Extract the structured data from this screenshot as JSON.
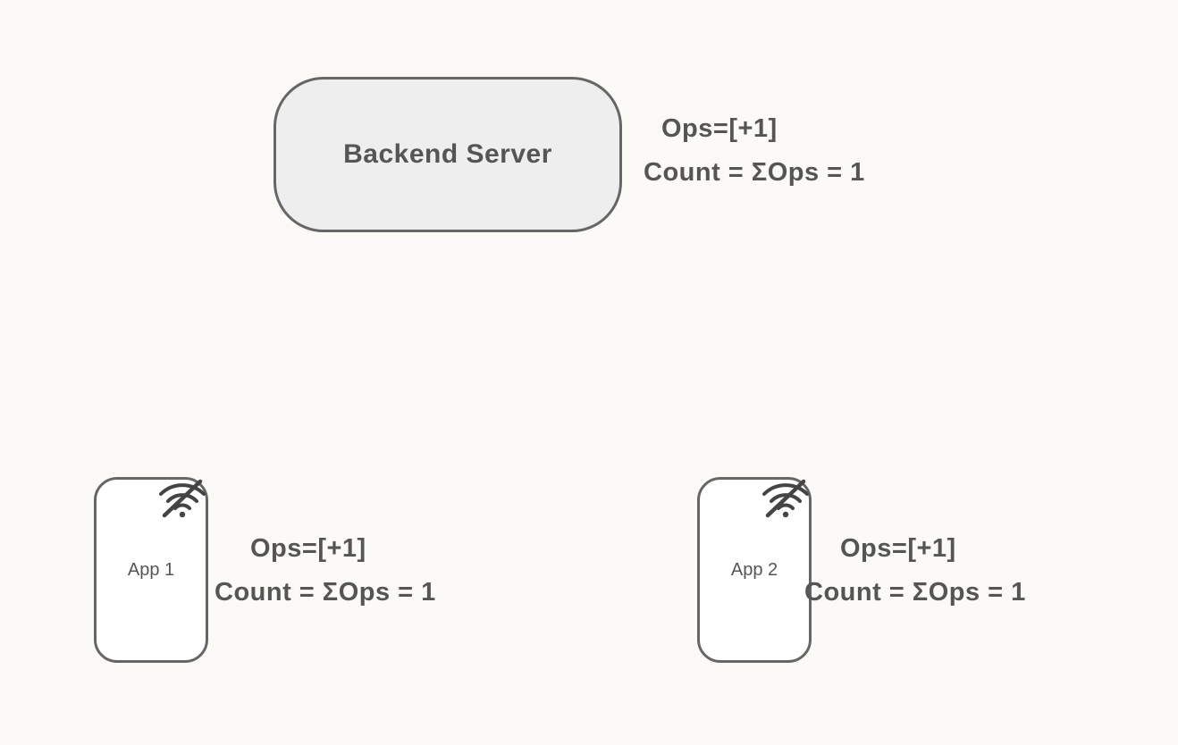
{
  "server": {
    "label": "Backend Server",
    "ops_line": "Ops=[+1]",
    "count_line": "Count = ΣOps = 1"
  },
  "apps": {
    "app1": {
      "label": "App 1",
      "ops_line": "Ops=[+1]",
      "count_line": "Count = ΣOps = 1"
    },
    "app2": {
      "label": "App 2",
      "ops_line": "Ops=[+1]",
      "count_line": "Count = ΣOps = 1"
    }
  }
}
